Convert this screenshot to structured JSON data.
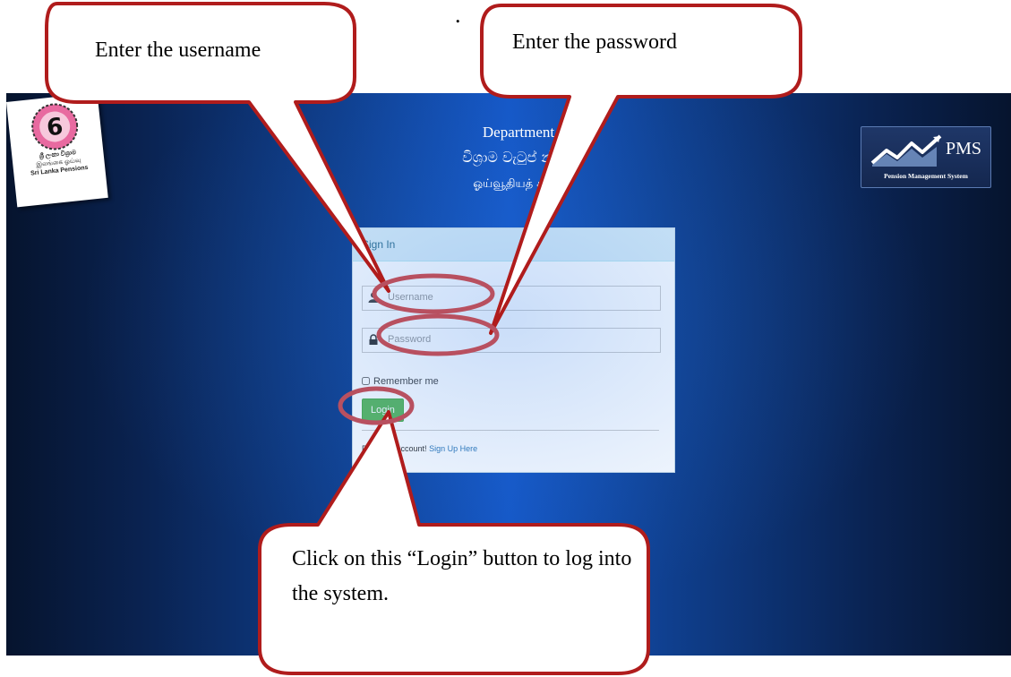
{
  "annotations": {
    "username": "Enter the username",
    "password": "Enter the password",
    "login": "Click on this “Login” button to log into the system.",
    "stray_mark": "."
  },
  "header": {
    "logo_lines": [
      "ශ්‍රී ලංකා විශ්‍රාම",
      "இலங்கை ஓய்வு",
      "Sri Lanka Pensions"
    ],
    "department_en": "Department",
    "department_si": "විශ්‍රාම වැටුප්          න්තුව",
    "department_ta": "ஓய்வூதியத்          களம்",
    "pms_title": "PMS",
    "pms_subtitle": "Pension Management System"
  },
  "login": {
    "panel_title": "Sign In",
    "username_placeholder": "Username",
    "password_placeholder": "Password",
    "remember_label": "Remember me",
    "login_button": "Login",
    "signup_prefix": "Do  ve an account!",
    "signup_link": "Sign Up Here"
  },
  "colors": {
    "callout_border": "#b01c1c",
    "ellipse": "#b85060",
    "panel_header": "#d9edf7",
    "login_button": "#5cb85c",
    "background_center": "#1557c6",
    "background_edge": "#06142e"
  }
}
